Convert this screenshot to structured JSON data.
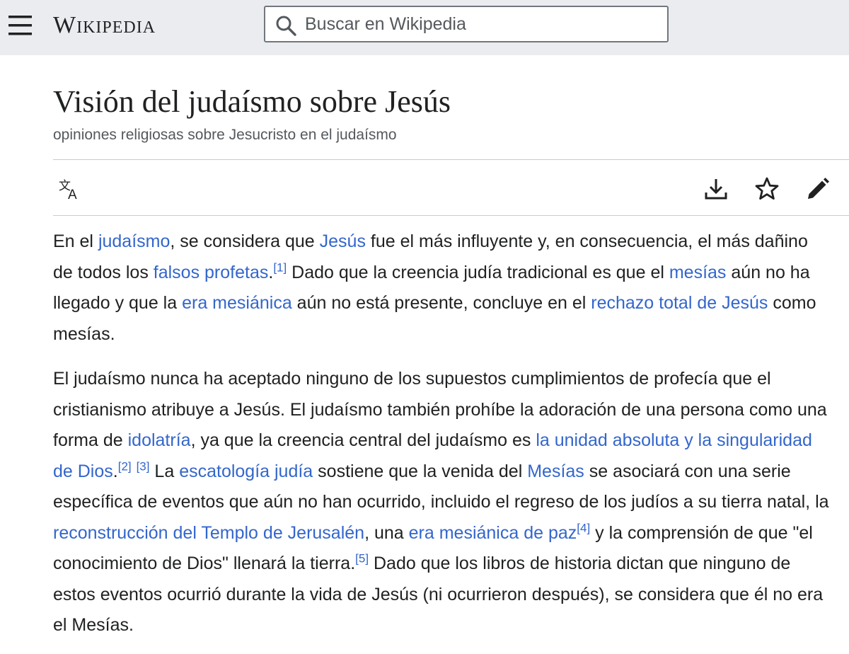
{
  "header": {
    "brand": "Wikipedia",
    "search_placeholder": "Buscar en Wikipedia"
  },
  "article": {
    "title": "Visión del judaísmo sobre Jesús",
    "subtitle": "opiniones religiosas sobre Jesucristo en el judaísmo"
  },
  "toolbar": {
    "icons": [
      "translate-icon",
      "download-icon",
      "star-icon",
      "edit-pencil-icon"
    ]
  },
  "body": {
    "p1": {
      "t1": "En el ",
      "l1": "judaísmo",
      "t2": ", se considera que ",
      "l2": "Jesús",
      "t3": " fue el más influyente y, en consecuencia, el más dañino de todos los ",
      "l3": "falsos profetas",
      "t4": ".",
      "ref1": "[1]",
      "t5": " Dado que la creencia judía tradicional es que el ",
      "l4": "mesías",
      "t6": " aún no ha llegado y que la ",
      "l5": "era mesiánica",
      "t7": " aún no está presente, concluye en el ",
      "l6": "rechazo total de Jesús",
      "t8": " como mesías."
    },
    "p2": {
      "t1": "El judaísmo nunca ha aceptado ninguno de los supuestos cumplimientos de profecía que el cristianismo atribuye a Jesús. El judaísmo también prohíbe la adoración de una persona como una forma de ",
      "l1": "idolatría",
      "t2": ", ya que la creencia central del judaísmo es ",
      "l2": "la unidad absoluta y la singularidad de Dios",
      "t3": ".",
      "ref2": "[2]",
      "ref3": "[3]",
      "t4": " La ",
      "l3": "escatología judía",
      "t5": " sostiene que la venida del ",
      "l4": "Mesías",
      "t6": " se asociará con una serie específica de eventos que aún no han ocurrido, incluido el regreso de los judíos a su tierra natal, la ",
      "l5": "reconstrucción del Templo de Jerusalén",
      "t7": ", una ",
      "l6": "era mesiánica de paz",
      "ref4": "[4]",
      "t8": " y la comprensión de que \"el conocimiento de Dios\" llenará la tierra.",
      "ref5": "[5]",
      "t9": " Dado que los libros de historia dictan que ninguno de estos eventos ocurrió durante la vida de Jesús (ni ocurrieron después), se considera que él no era el Mesías."
    }
  }
}
